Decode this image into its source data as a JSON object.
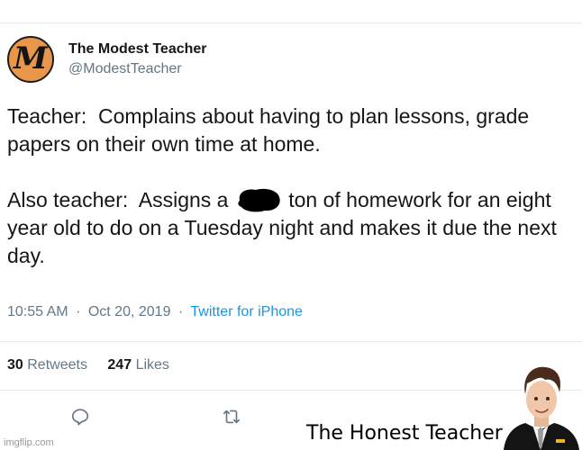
{
  "tweet": {
    "avatar_letter": "M",
    "display_name": "The Modest Teacher",
    "handle": "@ModestTeacher",
    "paragraph1": "Teacher:  Complains about having to plan lessons, grade papers on their own time at home.",
    "paragraph2_before": "Also teacher:  Assigns a ",
    "paragraph2_after": " ton of homework for an eight year old to do on a Tuesday night and makes it due the next day.",
    "time": "10:55 AM",
    "date": "Oct 20, 2019",
    "separator": "·",
    "source": "Twitter for iPhone",
    "retweets_count": "30",
    "retweets_label": "Retweets",
    "likes_count": "247",
    "likes_label": "Likes"
  },
  "meme": {
    "caption": "The Honest Teacher",
    "watermark": "imgflip.com"
  },
  "icons": {
    "reply": "reply-icon",
    "retweet": "retweet-icon"
  },
  "colors": {
    "avatar_bg": "#e8964a",
    "link": "#1b95e0",
    "muted": "#657786",
    "text": "#14171a"
  }
}
